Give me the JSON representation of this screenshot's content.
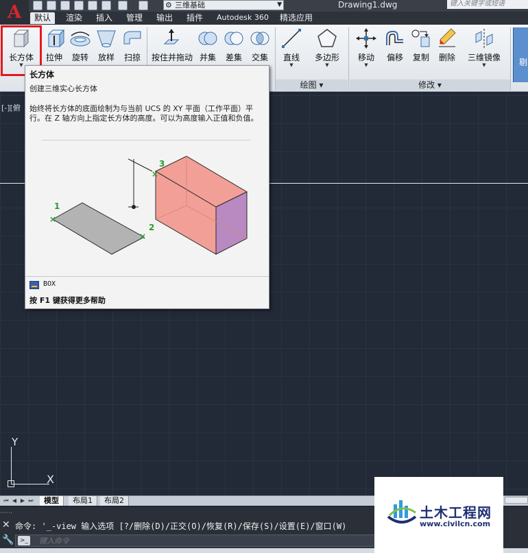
{
  "titlebar": {
    "workspace": "三维基础",
    "document": "Drawing1.dwg",
    "search_placeholder": "键入关键字或短语"
  },
  "tabs": [
    {
      "label": "默认",
      "active": true
    },
    {
      "label": "渲染"
    },
    {
      "label": "插入"
    },
    {
      "label": "管理"
    },
    {
      "label": "输出"
    },
    {
      "label": "插件"
    },
    {
      "label": "Autodesk 360"
    },
    {
      "label": "精选应用"
    }
  ],
  "ribbon": {
    "create": [
      "长方体",
      "拉伸",
      "旋转",
      "放样",
      "扫掠"
    ],
    "solid": [
      "按住并拖动",
      "并集",
      "差集",
      "交集"
    ],
    "draw": [
      "直线",
      "多边形"
    ],
    "modify": [
      "移动",
      "偏移",
      "复制",
      "删除",
      "三维镜像"
    ],
    "extra": "剔",
    "panel_draw": "绘图",
    "panel_modify": "修改"
  },
  "view_label": "[-][俯",
  "tooltip": {
    "title": "长方体",
    "subtitle": "创建三维实心长方体",
    "description": "始终将长方体的底面绘制为与当前 UCS 的 XY 平面（工作平面）平行。在 Z 轴方向上指定长方体的高度。可以为高度输入正值和负值。",
    "command": "BOX",
    "help": "按 F1 键获得更多帮助",
    "points": [
      "1",
      "2",
      "3"
    ]
  },
  "ucs": {
    "y": "Y",
    "x": "X"
  },
  "layout_tabs": [
    {
      "label": "模型",
      "active": true
    },
    {
      "label": "布局1"
    },
    {
      "label": "布局2"
    }
  ],
  "command_line": {
    "history": "命令: '_-view 输入选项 [?/删除(D)/正交(O)/恢复(R)/保存(S)/设置(E)/窗口(W)",
    "placeholder": "键入命令"
  },
  "watermark": {
    "name": "土木工程网",
    "url": "www.civilcn.com"
  },
  "colors": {
    "highlight": "#e4181f",
    "box_front": "#f2a097",
    "box_side": "#b98ac1",
    "canvas": "#222937"
  }
}
